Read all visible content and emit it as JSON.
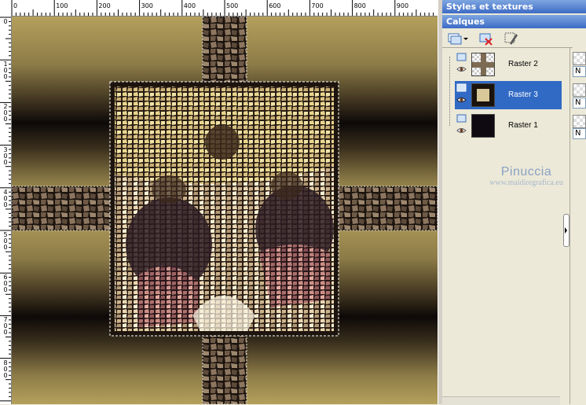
{
  "ruler": {
    "top_labels": [
      "0",
      "100",
      "200",
      "300",
      "400",
      "500",
      "600",
      "700",
      "800",
      "900"
    ],
    "left_labels": [
      "0",
      "1\n0\n0",
      "2\n0\n0",
      "3\n0\n0",
      "4\n0\n0",
      "5\n0\n0",
      "6\n0\n0",
      "7\n0\n0",
      "8\n0\n0"
    ]
  },
  "panel": {
    "styles_title": "Styles et textures",
    "layers_title": "Calques",
    "layers": [
      {
        "name": "Raster 2",
        "selected": false
      },
      {
        "name": "Raster 3",
        "selected": true
      },
      {
        "name": "Raster 1",
        "selected": false
      }
    ],
    "right_fields": [
      "N",
      "N",
      "N"
    ]
  },
  "watermark": {
    "title": "Pinuccia",
    "url": "www.maidiregrafica.eu"
  },
  "colors": {
    "gold": "#b8a35f",
    "dark": "#100b08",
    "selection": "#316ac5",
    "panel_title": "#3d6bc6"
  },
  "icons": [
    "new-layer-icon",
    "dropdown-arrow-icon",
    "delete-layer-icon",
    "layer-properties-icon",
    "eye-icon",
    "raster-layer-icon"
  ]
}
